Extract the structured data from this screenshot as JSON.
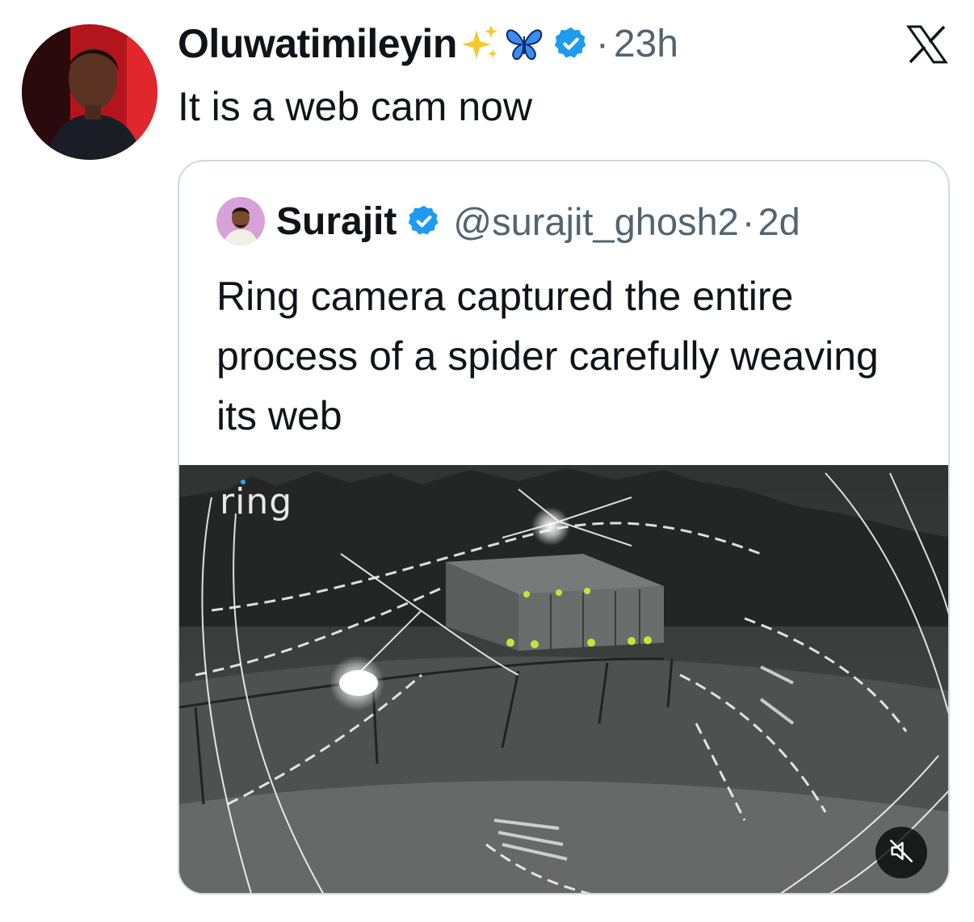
{
  "tweet": {
    "display_name": "Oluwatimileyin",
    "emojis": [
      "sparkles-emoji",
      "butterfly-emoji"
    ],
    "separator": "·",
    "time": "23h",
    "text": "It is a web cam now"
  },
  "quoted_tweet": {
    "display_name": "Surajit",
    "handle": "@surajit_ghosh2",
    "separator": "·",
    "time": "2d",
    "text": "Ring camera captured the entire process of a spider carefully weaving its web",
    "media": {
      "type": "video",
      "watermark": "ring",
      "muted": true
    }
  },
  "colors": {
    "text_primary": "#0f1419",
    "text_secondary": "#536471",
    "verified_blue": "#1d9bf0",
    "card_border": "#cfd9de"
  },
  "icons": {
    "platform": "x-logo-icon",
    "verified": "verified-badge-icon",
    "mute": "muted-speaker-icon"
  }
}
